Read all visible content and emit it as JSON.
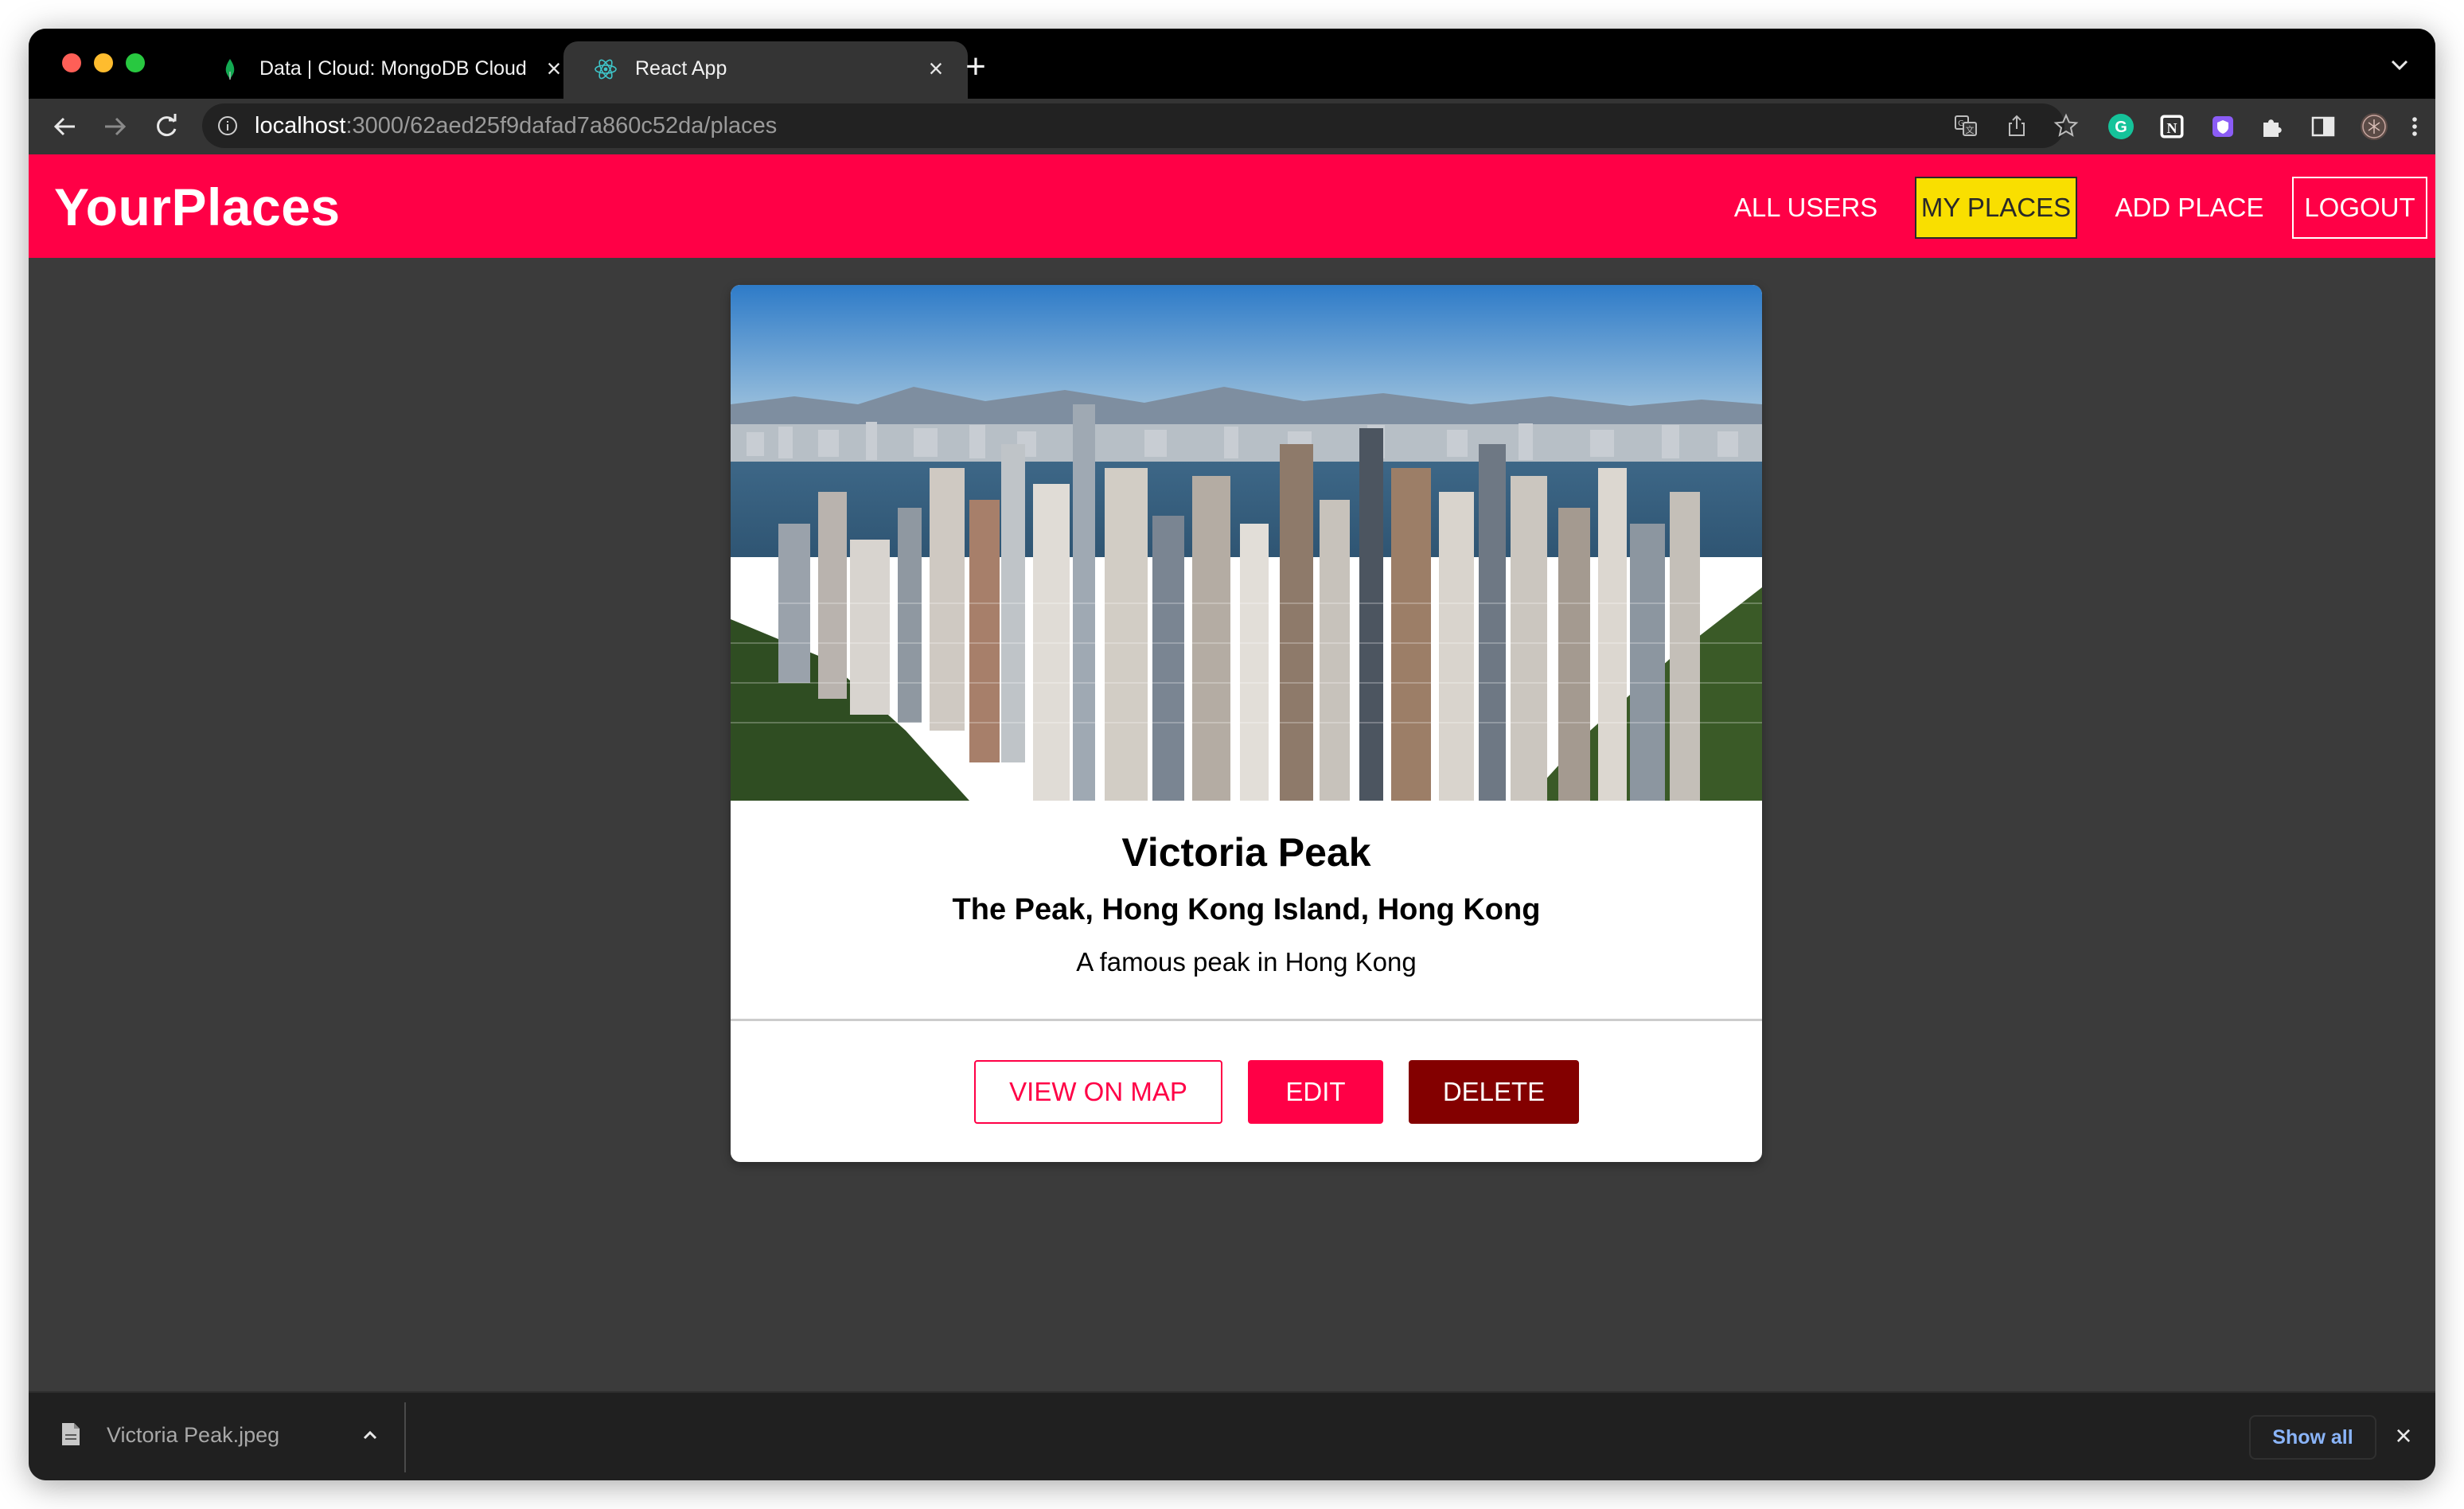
{
  "browser": {
    "tabs": [
      {
        "title": "Data | Cloud: MongoDB Cloud",
        "favicon": "mongodb-leaf-icon",
        "active": false
      },
      {
        "title": "React App",
        "favicon": "react-icon",
        "active": true
      }
    ],
    "close_glyph": "×",
    "new_tab_glyph": "+",
    "url": {
      "host": "localhost",
      "path": ":3000/62aed25f9dafad7a860c52da/places"
    },
    "extension_icons": [
      "grammarly-icon",
      "notion-icon",
      "shield-extension-icon",
      "puzzle-icon",
      "side-panel-icon",
      "avatar",
      "menu-dots-icon"
    ]
  },
  "app": {
    "brand": "YourPlaces",
    "brand_color": "#ff0046",
    "nav": {
      "all_users": "ALL USERS",
      "my_places": "MY PLACES",
      "add_place": "ADD PLACE",
      "logout": "LOGOUT"
    },
    "active_nav_color": "#f9df00"
  },
  "place": {
    "title": "Victoria Peak",
    "address": "The Peak, Hong Kong Island, Hong Kong",
    "description": "A famous peak in Hong Kong",
    "actions": {
      "view_on_map": "VIEW ON MAP",
      "edit": "EDIT",
      "delete": "DELETE"
    },
    "delete_color": "#830000"
  },
  "downloads": {
    "file_name": "Victoria Peak.jpeg",
    "show_all": "Show all",
    "close_glyph": "×"
  }
}
